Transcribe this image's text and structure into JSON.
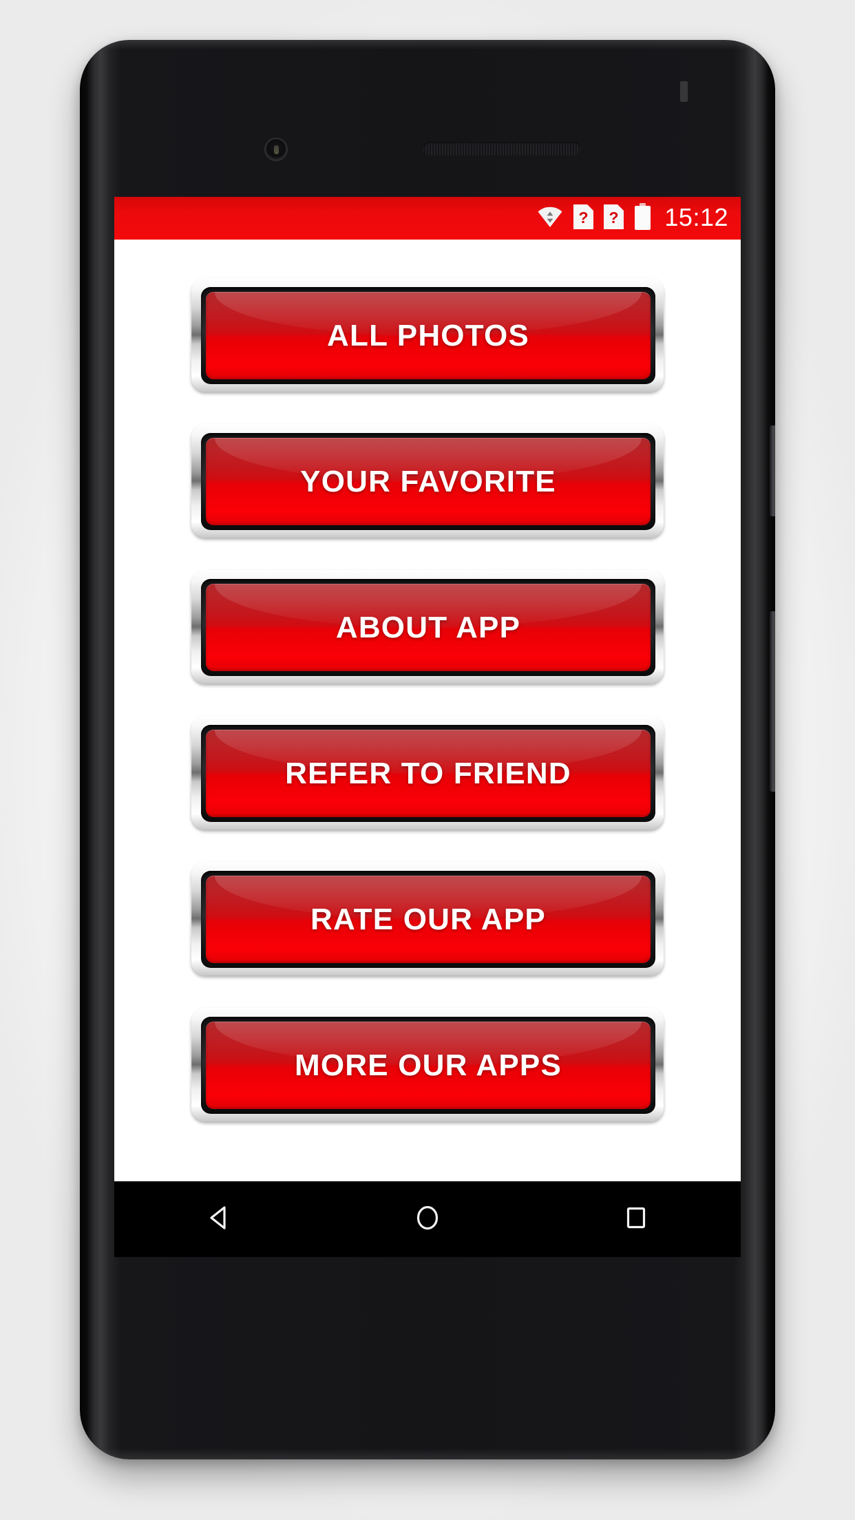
{
  "device": {
    "hardware": {
      "front_camera": "front-camera",
      "earpiece": "earpiece-speaker",
      "sensor": "proximity-sensor",
      "antenna": "antenna-band",
      "power_button": "power-button",
      "volume_rocker": "volume-rocker"
    }
  },
  "status_bar": {
    "background_color": "#ec0a0c",
    "clock": "15:12",
    "icons": [
      {
        "name": "wifi-icon",
        "label": "wifi"
      },
      {
        "name": "sim-card-1-icon",
        "label": "?"
      },
      {
        "name": "sim-card-2-icon",
        "label": "?"
      },
      {
        "name": "battery-icon",
        "label": "battery"
      }
    ]
  },
  "app": {
    "accent_color": "#ec0a0c",
    "background_color": "#ffffff",
    "buttons": [
      {
        "id": "all-photos",
        "label": "ALL PHOTOS"
      },
      {
        "id": "your-favorite",
        "label": "YOUR FAVORITE"
      },
      {
        "id": "about-app",
        "label": "ABOUT APP"
      },
      {
        "id": "refer-to-friend",
        "label": "REFER TO FRIEND"
      },
      {
        "id": "rate-our-app",
        "label": "RATE OUR APP"
      },
      {
        "id": "more-our-apps",
        "label": "MORE OUR APPS"
      }
    ]
  },
  "nav_bar": {
    "background_color": "#000000",
    "items": [
      {
        "name": "back-button",
        "icon": "back-triangle-icon"
      },
      {
        "name": "home-button",
        "icon": "home-circle-icon"
      },
      {
        "name": "recents-button",
        "icon": "recents-square-icon"
      }
    ]
  }
}
